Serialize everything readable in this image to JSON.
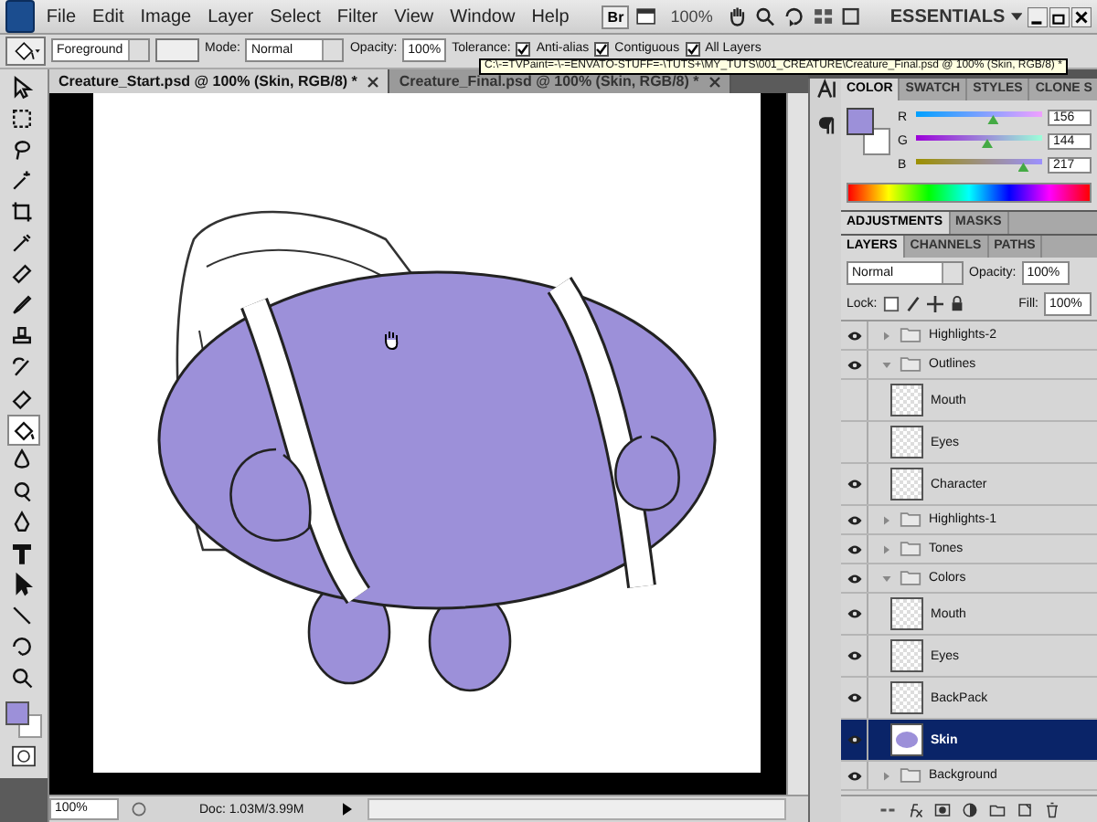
{
  "menu": [
    "File",
    "Edit",
    "Image",
    "Layer",
    "Select",
    "Filter",
    "View",
    "Window",
    "Help"
  ],
  "app_bar": {
    "bridge": "Br",
    "zoom": "100%",
    "workspace": "ESSENTIALS"
  },
  "options": {
    "fill_source": "Foreground",
    "mode_label": "Mode:",
    "mode": "Normal",
    "opacity_label": "Opacity:",
    "opacity": "100%",
    "tolerance_label": "Tolerance:",
    "checkboxes": [
      {
        "label": "Anti-alias",
        "checked": true
      },
      {
        "label": "Contiguous",
        "checked": true
      },
      {
        "label": "All Layers",
        "checked": true
      }
    ]
  },
  "tooltip": "C:\\-=TVPaint=-\\-=ENVATO-STUFF=-\\TUTS+\\MY_TUTS\\001_CREATURE\\Creature_Final.psd @ 100% (Skin, RGB/8) *",
  "documents": [
    {
      "title": "Creature_Start.psd @ 100% (Skin, RGB/8) *",
      "selected": true
    },
    {
      "title": "Creature_Final.psd @ 100% (Skin, RGB/8) *",
      "selected": false
    }
  ],
  "tools": [
    {
      "kind": "move",
      "selected": false
    },
    {
      "kind": "marquee",
      "selected": false
    },
    {
      "kind": "lasso",
      "selected": false
    },
    {
      "kind": "wand",
      "selected": false
    },
    {
      "kind": "crop",
      "selected": false
    },
    {
      "kind": "eyedropper",
      "selected": false
    },
    {
      "kind": "bandage",
      "selected": false
    },
    {
      "kind": "brush",
      "selected": false
    },
    {
      "kind": "stamp",
      "selected": false
    },
    {
      "kind": "history",
      "selected": false
    },
    {
      "kind": "eraser",
      "selected": false
    },
    {
      "kind": "bucket",
      "selected": true
    },
    {
      "kind": "blur",
      "selected": false
    },
    {
      "kind": "dodge",
      "selected": false
    },
    {
      "kind": "pen",
      "selected": false
    },
    {
      "kind": "type",
      "selected": false
    },
    {
      "kind": "arrow",
      "selected": false
    },
    {
      "kind": "line",
      "selected": false
    },
    {
      "kind": "rotate",
      "selected": false
    },
    {
      "kind": "zoom",
      "selected": false
    }
  ],
  "status_bar": {
    "zoom": "100%",
    "doc": "Doc: 1.03M/3.99M"
  },
  "color_panel": {
    "tabs": [
      {
        "label": "COLOR",
        "selected": true
      },
      {
        "label": "SWATCH",
        "selected": false
      },
      {
        "label": "STYLES",
        "selected": false
      },
      {
        "label": "CLONE S",
        "selected": false
      }
    ],
    "channels": [
      {
        "name": "R",
        "level": 0.612,
        "reading": "156"
      },
      {
        "name": "G",
        "level": 0.565,
        "reading": "144"
      },
      {
        "name": "B",
        "level": 0.851,
        "reading": "217"
      }
    ]
  },
  "adjustments_panel": {
    "tabs": [
      {
        "label": "ADJUSTMENTS",
        "selected": true
      },
      {
        "label": "MASKS",
        "selected": false
      }
    ]
  },
  "layers_panel": {
    "tabs": [
      {
        "label": "LAYERS",
        "selected": true
      },
      {
        "label": "CHANNELS",
        "selected": false
      },
      {
        "label": "PATHS",
        "selected": false
      }
    ],
    "blend_mode": "Normal",
    "opacity_label": "Opacity:",
    "opacity": "100%",
    "lock_label": "Lock:",
    "fill_label": "Fill:",
    "fill": "100%",
    "layers": [
      {
        "name": "Highlights-2",
        "kind": "group",
        "visible": true,
        "expanded": false,
        "selected": false
      },
      {
        "name": "Outlines",
        "kind": "group",
        "visible": true,
        "expanded": true,
        "selected": false,
        "children": [
          {
            "name": "Mouth",
            "kind": "empty",
            "visible": false,
            "selected": false
          },
          {
            "name": "Eyes",
            "kind": "empty",
            "visible": false,
            "selected": false
          },
          {
            "name": "Character",
            "kind": "empty",
            "visible": true,
            "selected": false
          }
        ]
      },
      {
        "name": "Highlights-1",
        "kind": "group",
        "visible": true,
        "expanded": false,
        "selected": false
      },
      {
        "name": "Tones",
        "kind": "group",
        "visible": true,
        "expanded": false,
        "selected": false
      },
      {
        "name": "Colors",
        "kind": "group",
        "visible": true,
        "expanded": true,
        "selected": false,
        "children": [
          {
            "name": "Mouth",
            "kind": "empty",
            "visible": true,
            "selected": false
          },
          {
            "name": "Eyes",
            "kind": "empty",
            "visible": true,
            "selected": false
          },
          {
            "name": "BackPack",
            "kind": "empty",
            "visible": true,
            "selected": false
          },
          {
            "name": "Skin",
            "kind": "painted",
            "visible": true,
            "selected": true
          }
        ]
      },
      {
        "name": "Background",
        "kind": "group",
        "visible": true,
        "expanded": false,
        "selected": false
      }
    ]
  }
}
